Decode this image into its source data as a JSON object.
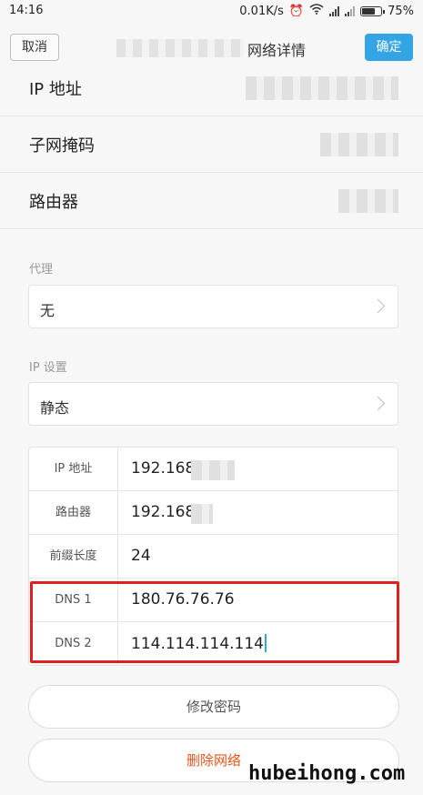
{
  "status_bar": {
    "time": "14:16",
    "speed": "0.01K/s",
    "battery_text": "75%",
    "battery_level": 0.75
  },
  "title_bar": {
    "cancel_label": "取消",
    "title": "网络详情",
    "ok_label": "确定"
  },
  "info": {
    "ip_label": "IP 地址",
    "subnet_label": "子网掩码",
    "router_label": "路由器"
  },
  "proxy": {
    "section_label": "代理",
    "value": "无"
  },
  "ip_settings": {
    "section_label": "IP 设置",
    "value": "静态"
  },
  "static_fields": [
    {
      "key": "IP 地址",
      "value": "192.168."
    },
    {
      "key": "路由器",
      "value": "192.168."
    },
    {
      "key": "前缀长度",
      "value": "24"
    },
    {
      "key": "DNS 1",
      "value": "180.76.76.76"
    },
    {
      "key": "DNS 2",
      "value": "114.114.114.114"
    }
  ],
  "actions": {
    "change_password": "修改密码",
    "delete_network": "删除网络"
  },
  "watermark": "hubeihong.com",
  "colors": {
    "accent": "#33a4e4",
    "delete": "#e8561d",
    "highlight": "#e02020"
  }
}
